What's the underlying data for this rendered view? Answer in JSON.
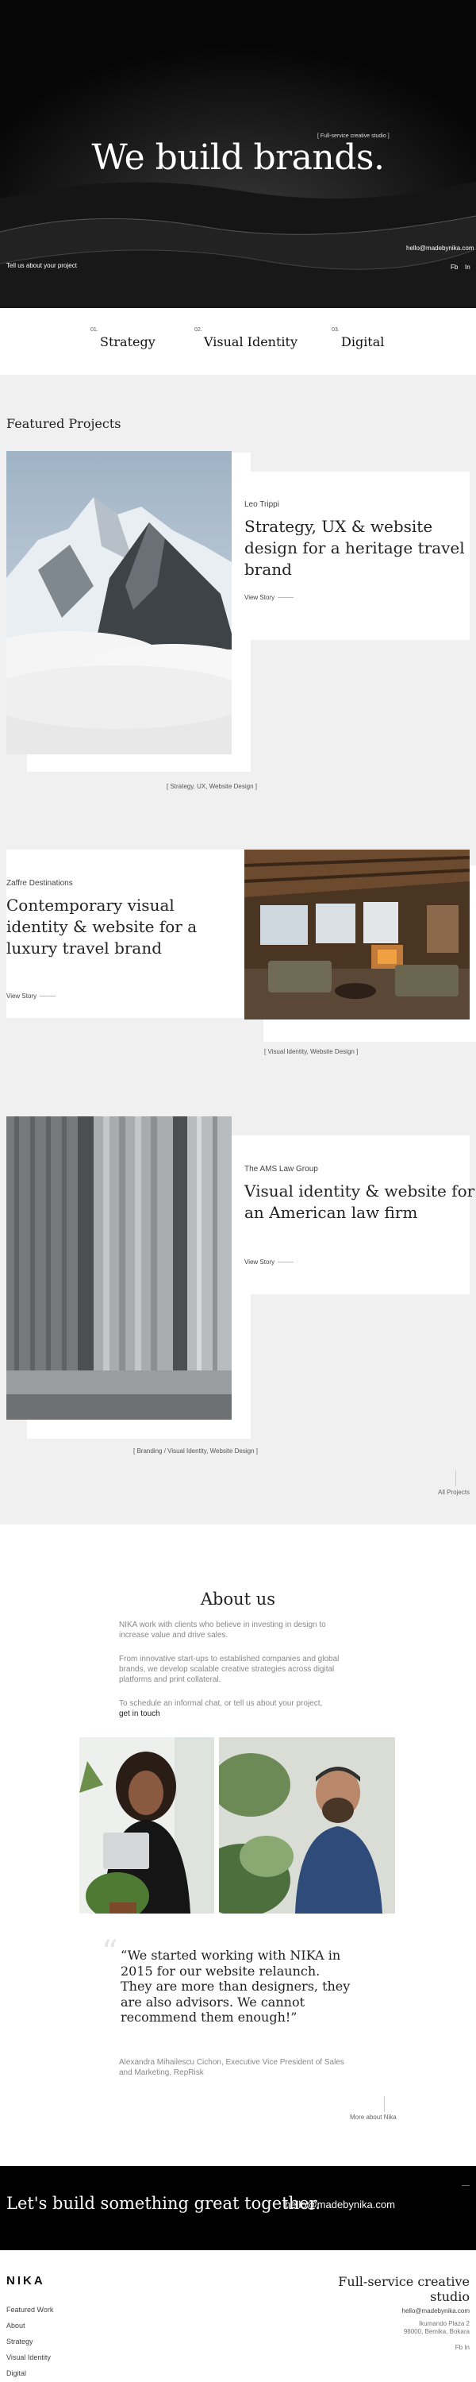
{
  "hero": {
    "badge": "[ Full-service creative studio ]",
    "title": "We build brands.",
    "email": "hello@madebynika.com",
    "tell": "Tell us about your project",
    "social": {
      "fb": "Fb",
      "in": "In"
    }
  },
  "services": [
    {
      "num": "01.",
      "label": "Strategy"
    },
    {
      "num": "02.",
      "label": "Visual Identity"
    },
    {
      "num": "03.",
      "label": "Digital"
    }
  ],
  "featured": {
    "heading": "Featured Projects",
    "view_label": "View Story",
    "projects": [
      {
        "client": "Leo Trippi",
        "title": "Strategy, UX & website design for a heritage travel brand",
        "tags": "[ Strategy, UX, Website Design ]"
      },
      {
        "client": "Zaffre Destinations",
        "title": "Contemporary visual identity & website for a luxury travel brand",
        "tags": "[ Visual Identity, Website Design ]"
      },
      {
        "client": "The AMS Law Group",
        "title": "Visual identity & website for an American law firm",
        "tags": "[ Branding / Visual Identity, Website Design ]"
      }
    ],
    "all_projects": "All Projects"
  },
  "about": {
    "heading": "About us",
    "p1": "NIKA work with clients who believe in investing in design to increase value and drive sales.",
    "p2": "From innovative start-ups to established companies and global brands, we develop scalable creative strategies across digital platforms and print collateral.",
    "p3": "To schedule an informal chat, or tell us about your project,",
    "p3_link": "get in touch",
    "quote": "“We started working with NIKA in 2015 for our website relaunch. They are more than designers, they are also advisors. We cannot recommend them enough!”",
    "quote_by": "Alexandra Mihailescu Cichon, Executive Vice President of Sales and Marketing, RepRisk",
    "more": "More about Nika"
  },
  "cta": {
    "text": "Let's build something great together.",
    "email": "hello@madebynika.com"
  },
  "footer": {
    "logo": "NIKA",
    "tagline": "Full-service creative studio",
    "nav": [
      "Featured Work",
      "About",
      "Strategy",
      "Visual Identity",
      "Digital"
    ],
    "email": "hello@madebynika.com",
    "address1": "Ikumando Plaza 2",
    "address2": "98000, Bemika, Bokara",
    "social": "Fb  In"
  }
}
